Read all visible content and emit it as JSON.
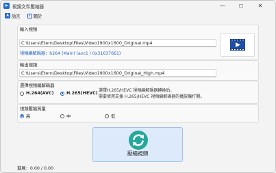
{
  "window": {
    "title": "視頻文件壓縮器",
    "buttons": {
      "minimize": "—",
      "maximize": "☐",
      "close": "✕"
    }
  },
  "menu": {
    "language_label": "語言",
    "language_icon_glyph": "A",
    "about_label": "關於",
    "about_icon_glyph": "i"
  },
  "input": {
    "title": "輸入視頻",
    "path": "C:\\Users\\Etern\\Desktop\\Files\\Video1900x1600_Original.mp4",
    "codec_info": "視頻編解碼器：h264 (Main) (avc1 / 0x31637661)",
    "thumbnail_icon": "video-thumbnail-icon"
  },
  "output": {
    "title": "輸出視頻",
    "path": "C:\\Users\\Etern\\Desktop\\Files\\Video1900x1600_Original_High.mp4"
  },
  "codec": {
    "title": "選擇視頻編解碼器",
    "options": [
      {
        "label": "H.264(AVC)",
        "selected": false
      },
      {
        "label": "H.265(HEVC)",
        "selected": true
      }
    ],
    "hint_line1": "選擇H.265/HEVC 視頻編解碼器轉換后，",
    "hint_line2": "需要使用支援 H.265/HEVC 視頻編解碼器的播放機打開。"
  },
  "quality": {
    "title": "視頻壓縮質量",
    "options": [
      {
        "label": "高",
        "selected": true
      },
      {
        "label": "中",
        "selected": false
      },
      {
        "label": "低",
        "selected": false
      }
    ]
  },
  "compress": {
    "label": "壓縮視頻",
    "icon": "refresh-cycle-icon"
  },
  "progress": {
    "text": "進展：0.00 / 0.00"
  },
  "colors": {
    "accent": "#1f5fbf",
    "button_bg": "#dceafc",
    "icon_green": "#25a89a"
  }
}
